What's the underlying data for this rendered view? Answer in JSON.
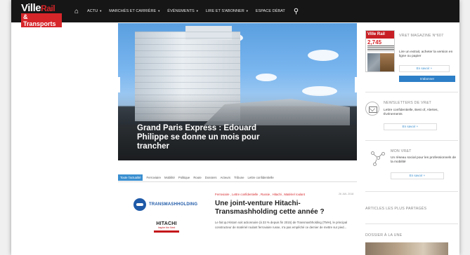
{
  "logo": {
    "line1_ville": "Ville",
    "line1_rail": "Rail",
    "line2": "& Transports"
  },
  "nav": {
    "home_icon": "home-icon",
    "items": [
      {
        "label": "ACTU",
        "has_caret": true
      },
      {
        "label": "MARCHÉS ET CARRIÈRE",
        "has_caret": true
      },
      {
        "label": "ÉVÉNEMENTS",
        "has_caret": true
      },
      {
        "label": "LIRE ET S'ABONNER",
        "has_caret": true
      },
      {
        "label": "ESPACE DÉBAT",
        "has_caret": false
      }
    ],
    "search_icon": "search-icon"
  },
  "hero": {
    "headline": "Grand Paris Express : Edouard Philippe se donne un mois pour trancher"
  },
  "categories": [
    {
      "label": "Toute l'actualité",
      "active": true
    },
    {
      "label": "Ferroviaire",
      "active": false
    },
    {
      "label": "Mobilité",
      "active": false
    },
    {
      "label": "Politique",
      "active": false
    },
    {
      "label": "Route",
      "active": false
    },
    {
      "label": "Dossiers",
      "active": false
    },
    {
      "label": "Acteurs",
      "active": false
    },
    {
      "label": "Tribune",
      "active": false
    },
    {
      "label": "Lettre confidentielle",
      "active": false
    }
  ],
  "article": {
    "logo1": "TRANSMASHHOLDING",
    "logo2_name": "HITACHI",
    "logo2_tagline": "Inspire the Next",
    "tags": "Ferroviaire , Lettre confidentielle , Russie , Hitachi , Matériel roulant",
    "date": "26 JUIL 2018",
    "title": "Une joint-venture Hitachi-Transmashholding cette année ?",
    "excerpt": "Le fait qu'Alstom soit actionnaire (à 33 % depuis fin 2015) de Transmashholding (TMH), le principal constructeur de matériel roulant ferroviaire russe, n'a pas empêché ce dernier de mettre sur pied..."
  },
  "sidebar": {
    "magazine": {
      "cover_title": "Ville Rail",
      "cover_number": "2,745",
      "heading": "VR&T MAGAZINE N°607",
      "text": "Lire un extrait, acheter la version en ligne ou papier",
      "more_label": "En savoir +",
      "subscribe_label": "S'abonner"
    },
    "newsletters": {
      "heading": "NEWSLETTERS DE VR&T",
      "text": "Lettre confidentielle, Best of, Alertes, Événements",
      "more_label": "En savoir +"
    },
    "mon_vrt": {
      "heading": "MON VR&T",
      "text": "Un réseau social pour les professionnels de la mobilité",
      "more_label": "En savoir +"
    },
    "shared_heading": "ARTICLES LES PLUS PARTAGÉS",
    "dossier_heading": "DOSSIER À LA UNE"
  },
  "colors": {
    "nav_bg": "#161616",
    "brand_red": "#d7262a",
    "accent_blue": "#3a8fd0"
  }
}
